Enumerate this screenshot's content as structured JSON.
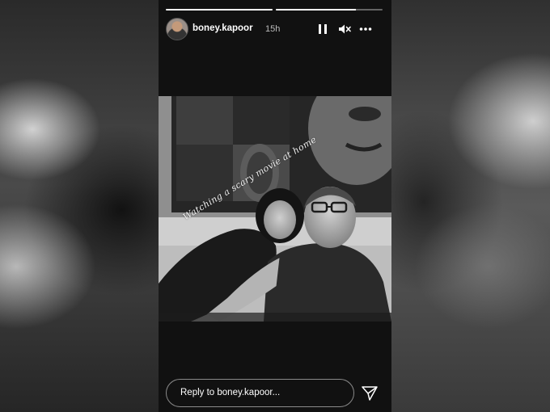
{
  "story": {
    "username": "boney.kapoor",
    "time": "15h",
    "progress": [
      1.0,
      0.75
    ],
    "caption": "Watching a scary movie at home",
    "reply_placeholder": "Reply to boney.kapoor...",
    "icons": {
      "pause": "pause-icon",
      "mute": "mute-icon",
      "more": "more-options-icon",
      "send": "send-icon"
    }
  }
}
